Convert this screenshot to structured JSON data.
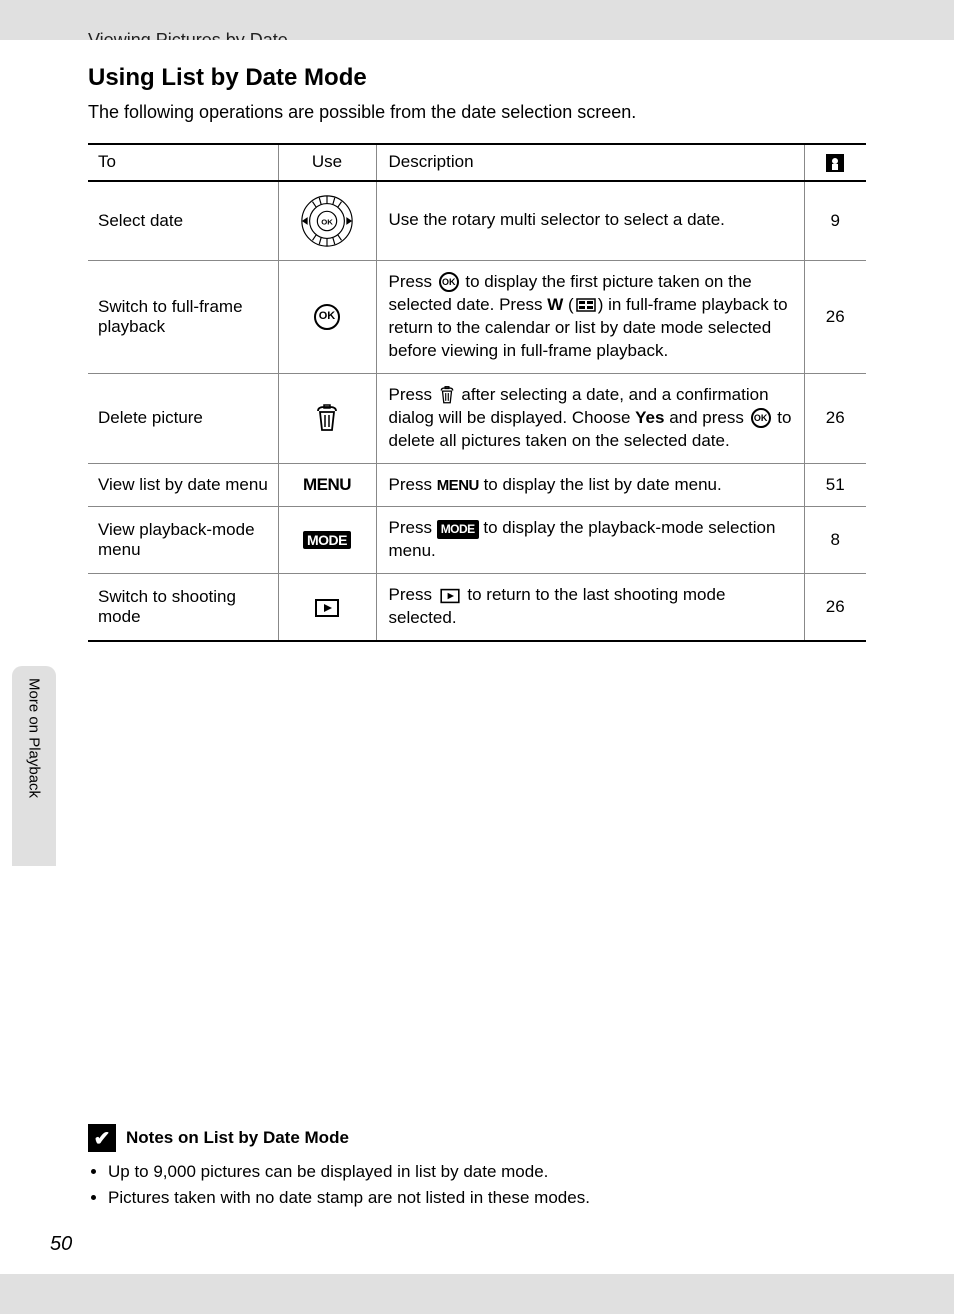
{
  "breadcrumb": "Viewing Pictures by Date",
  "heading": "Using List by Date Mode",
  "intro": "The following operations are possible from the date selection screen.",
  "side_tab": "More on Playback",
  "table": {
    "headers": {
      "to": "To",
      "use": "Use",
      "description": "Description"
    },
    "rows": [
      {
        "to": "Select date",
        "icon": "rotary",
        "desc_pre": "Use the rotary multi selector to select a date.",
        "page": "9"
      },
      {
        "to": "Switch to full-frame playback",
        "icon": "ok",
        "desc_pre": "Press ",
        "desc_mid": " to display the first picture taken on the selected date.\nPress ",
        "desc_mid2": " (",
        "desc_mid3": ") in full-frame playback to return to the calendar or list by date mode selected before viewing in full-frame playback.",
        "page": "26"
      },
      {
        "to": "Delete picture",
        "icon": "trash",
        "desc_pre": "Press ",
        "desc_mid": " after selecting a date, and a confirmation dialog will be displayed. Choose ",
        "bold_word": "Yes",
        "desc_mid2": " and press ",
        "desc_post": " to delete all pictures taken on the selected date.",
        "page": "26"
      },
      {
        "to": "View list by date menu",
        "icon": "menu",
        "desc_pre": "Press ",
        "desc_post": " to display the list by date menu.",
        "page": "51"
      },
      {
        "to": "View playback-mode menu",
        "icon": "mode",
        "desc_pre": "Press ",
        "desc_post": " to display the playback-mode selection menu.",
        "page": "8"
      },
      {
        "to": "Switch to shooting mode",
        "icon": "play",
        "desc_pre": "Press ",
        "desc_post": " to return to the last shooting mode selected.",
        "page": "26"
      }
    ]
  },
  "notes": {
    "title": "Notes on List by Date Mode",
    "items": [
      "Up to 9,000 pictures can be displayed in list by date mode.",
      "Pictures taken with no date stamp are not listed in these modes."
    ]
  },
  "page_number": "50",
  "labels": {
    "menu": "MENU",
    "mode": "MODE",
    "w": "W"
  }
}
